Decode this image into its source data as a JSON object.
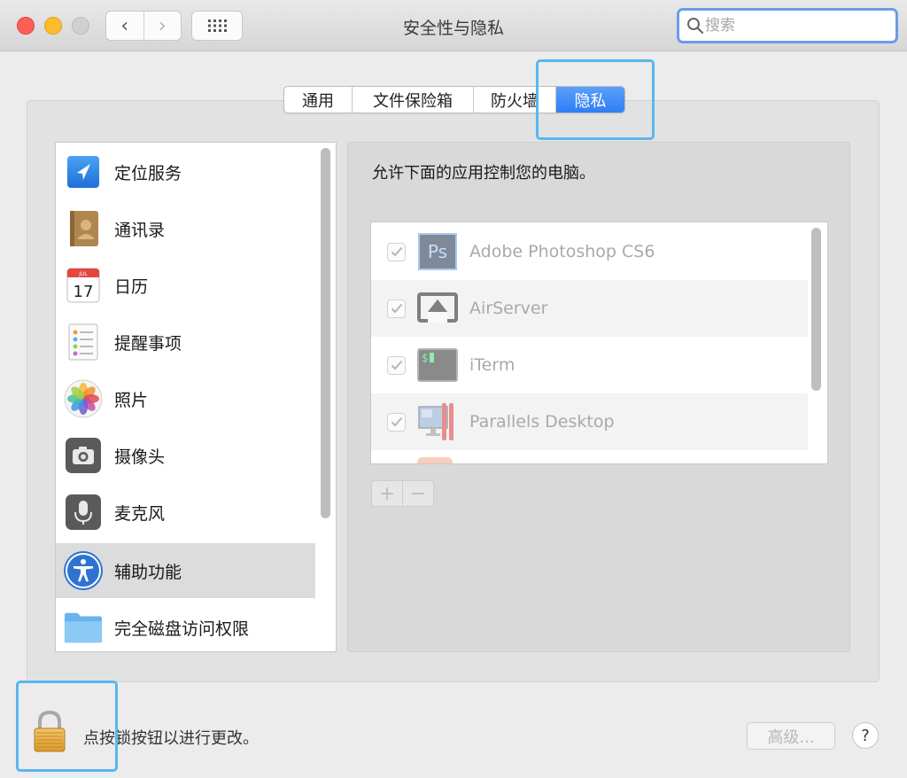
{
  "window": {
    "title": "安全性与隐私",
    "back_glyph": "‹",
    "forward_glyph": "›"
  },
  "search": {
    "placeholder": "搜索",
    "value": ""
  },
  "tabs": [
    {
      "label": "通用",
      "active": false
    },
    {
      "label": "文件保险箱",
      "active": false
    },
    {
      "label": "防火墙",
      "active": false
    },
    {
      "label": "隐私",
      "active": true
    }
  ],
  "sidebar": {
    "items": [
      {
        "label": "定位服务",
        "icon": "location-icon"
      },
      {
        "label": "通讯录",
        "icon": "contacts-icon"
      },
      {
        "label": "日历",
        "icon": "calendar-icon",
        "icon_month": "JUL",
        "icon_day": "17"
      },
      {
        "label": "提醒事项",
        "icon": "reminders-icon"
      },
      {
        "label": "照片",
        "icon": "photos-icon"
      },
      {
        "label": "摄像头",
        "icon": "camera-icon"
      },
      {
        "label": "麦克风",
        "icon": "microphone-icon"
      },
      {
        "label": "辅助功能",
        "icon": "accessibility-icon",
        "selected": true
      },
      {
        "label": "完全磁盘访问权限",
        "icon": "folder-icon"
      }
    ]
  },
  "pane": {
    "description": "允许下面的应用控制您的电脑。",
    "apps": [
      {
        "name": "Adobe Photoshop CS6",
        "checked": true,
        "icon": "photoshop-icon",
        "icon_text": "Ps"
      },
      {
        "name": "AirServer",
        "checked": true,
        "icon": "airserver-icon"
      },
      {
        "name": "iTerm",
        "checked": true,
        "icon": "iterm-icon",
        "icon_text": "$"
      },
      {
        "name": "Parallels Desktop",
        "checked": true,
        "icon": "parallels-icon"
      }
    ],
    "add_label": "+",
    "remove_label": "−"
  },
  "footer": {
    "lock_text": "点按锁按钮以进行更改。",
    "advanced_label": "高级...",
    "help_label": "?"
  },
  "colors": {
    "accent": "#3a87f6",
    "highlight": "#59b6ef",
    "search_focus": "#6b9ce6"
  }
}
